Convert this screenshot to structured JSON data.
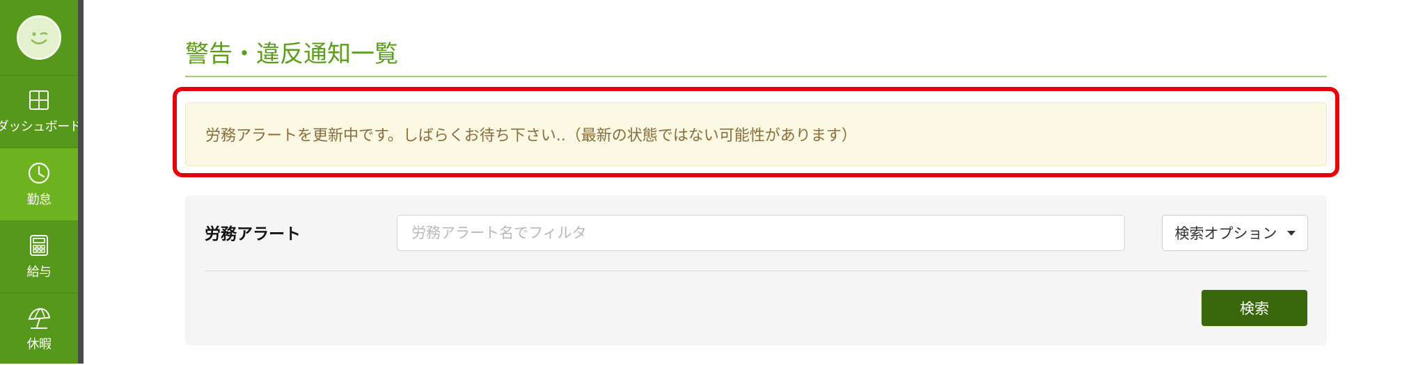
{
  "sidebar": {
    "items": [
      {
        "label": "ダッシュボード",
        "icon": "dashboard-icon",
        "active": false
      },
      {
        "label": "勤怠",
        "icon": "clock-icon",
        "active": true
      },
      {
        "label": "給与",
        "icon": "calculator-icon",
        "active": false
      },
      {
        "label": "休暇",
        "icon": "umbrella-icon",
        "active": false
      }
    ]
  },
  "page": {
    "title": "警告・違反通知一覧"
  },
  "alert": {
    "message": "労務アラートを更新中です。しばらくお待ち下さい..（最新の状態ではない可能性があります）"
  },
  "filter": {
    "label": "労務アラート",
    "placeholder": "労務アラート名でフィルタ",
    "value": "",
    "options_label": "検索オプション",
    "search_label": "検索"
  },
  "colors": {
    "sidebar": "#56981b",
    "sidebar_active": "#6cb31f",
    "title": "#5a9e1c",
    "alert_bg": "#fbf8e3",
    "alert_text": "#8a6d3b",
    "highlight": "#e8000b",
    "search_button": "#3a660c"
  }
}
